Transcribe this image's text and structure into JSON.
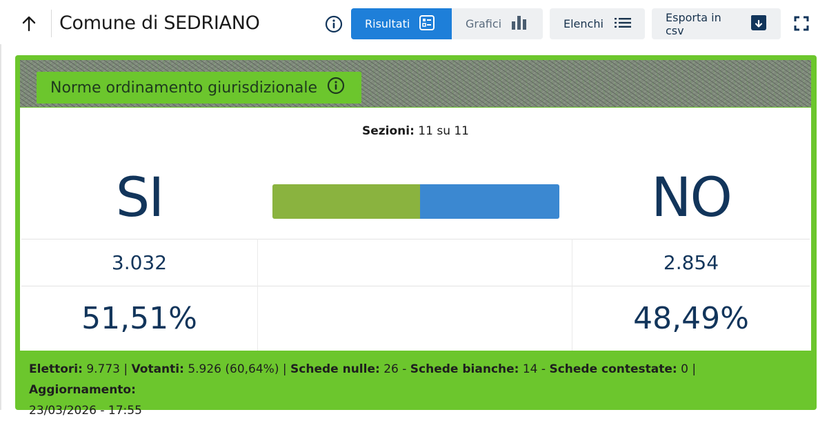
{
  "header": {
    "title": "Comune di SEDRIANO",
    "tabs": [
      {
        "label": "Risultati",
        "icon": "list-view-icon",
        "active": true
      },
      {
        "label": "Grafici",
        "icon": "bar-chart-icon",
        "active": false
      }
    ],
    "elenchi_label": "Elenchi",
    "esporta_label": "Esporta in csv"
  },
  "card": {
    "title": "Norme ordinamento giurisdizionale",
    "sezioni_label": "Sezioni:",
    "sezioni_value": "11 su 11",
    "si": {
      "label": "SI",
      "votes": "3.032",
      "percent": "51,51%",
      "share": 0.5151
    },
    "no": {
      "label": "NO",
      "votes": "2.854",
      "percent": "48,49%",
      "share": 0.4849
    },
    "colors": {
      "si": "#8ab33f",
      "no": "#3b88d1",
      "card": "#6cc62d"
    }
  },
  "footer": {
    "elettori_label": "Elettori:",
    "elettori": "9.773",
    "votanti_label": "Votanti:",
    "votanti": "5.926 (60,64%)",
    "nulle_label": "Schede nulle:",
    "nulle": "26",
    "bianche_label": "Schede bianche:",
    "bianche": "14",
    "contestate_label": "Schede contestate:",
    "contestate": "0",
    "aggiornamento_label": "Aggiornamento:",
    "aggiornamento": "23/03/2026 - 17:55"
  }
}
